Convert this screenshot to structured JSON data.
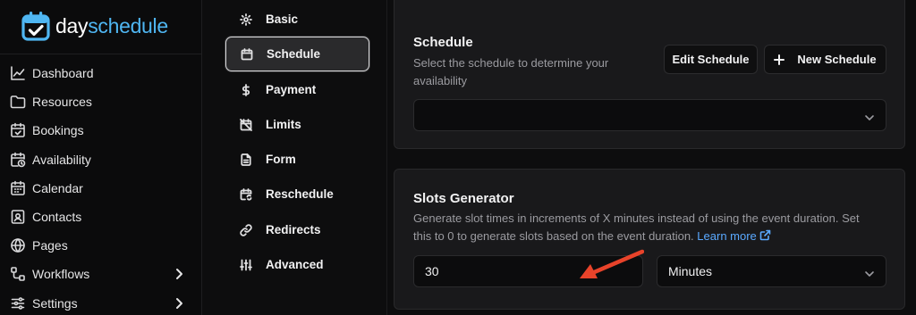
{
  "brand": {
    "day": "day",
    "schedule": "schedule",
    "accent": "#4fb6f2"
  },
  "sidebar": {
    "items": [
      {
        "label": "Dashboard",
        "icon": "chart-line-icon"
      },
      {
        "label": "Resources",
        "icon": "folder-icon"
      },
      {
        "label": "Bookings",
        "icon": "calendar-check-icon"
      },
      {
        "label": "Availability",
        "icon": "calendar-clock-icon"
      },
      {
        "label": "Calendar",
        "icon": "calendar-icon"
      },
      {
        "label": "Contacts",
        "icon": "contact-icon"
      },
      {
        "label": "Pages",
        "icon": "globe-icon"
      },
      {
        "label": "Workflows",
        "icon": "workflow-icon"
      },
      {
        "label": "Settings",
        "icon": "gear-icon"
      }
    ]
  },
  "submenu": {
    "items": [
      {
        "label": "Basic",
        "icon": "gear-icon"
      },
      {
        "label": "Schedule",
        "icon": "calendar-icon"
      },
      {
        "label": "Payment",
        "icon": "dollar-icon"
      },
      {
        "label": "Limits",
        "icon": "calendar-off-icon"
      },
      {
        "label": "Form",
        "icon": "file-text-icon"
      },
      {
        "label": "Reschedule",
        "icon": "calendar-sync-icon"
      },
      {
        "label": "Redirects",
        "icon": "link-icon"
      },
      {
        "label": "Advanced",
        "icon": "sliders-icon"
      }
    ],
    "active": "Schedule"
  },
  "schedule_card": {
    "title": "Schedule",
    "desc_line1": "Select the schedule to determine your",
    "desc_line2": "availability",
    "edit_label": "Edit Schedule",
    "new_label": "New Schedule",
    "select_value": ""
  },
  "slots_card": {
    "title": "Slots Generator",
    "desc_line1": "Generate slot times in increments of X minutes instead of using the event duration. Set",
    "desc_line2": "this to 0 to generate slots based on the event duration.",
    "learn_more": "Learn more",
    "increment_value": "30",
    "unit_value": "Minutes"
  },
  "colors": {
    "annotation_arrow": "#e8432a",
    "link": "#5aa9ff"
  }
}
